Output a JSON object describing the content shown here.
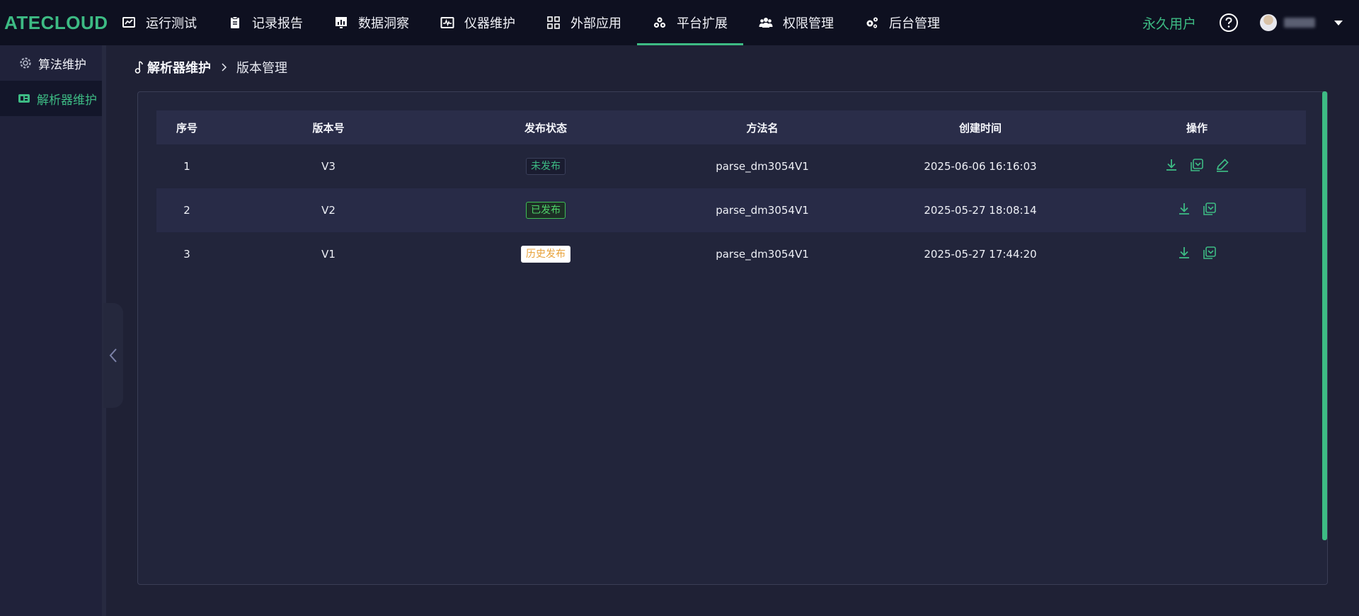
{
  "app": {
    "logo": "ATECLOUD"
  },
  "nav": {
    "items": [
      {
        "label": "运行测试",
        "icon": "chart-line-icon",
        "active": false
      },
      {
        "label": "记录报告",
        "icon": "clipboard-icon",
        "active": false
      },
      {
        "label": "数据洞察",
        "icon": "bar-chart-icon",
        "active": false
      },
      {
        "label": "仪器维护",
        "icon": "oscilloscope-icon",
        "active": false
      },
      {
        "label": "外部应用",
        "icon": "apps-grid-icon",
        "active": false
      },
      {
        "label": "平台扩展",
        "icon": "cubes-icon",
        "active": true
      },
      {
        "label": "权限管理",
        "icon": "users-icon",
        "active": false
      },
      {
        "label": "后台管理",
        "icon": "gears-icon",
        "active": false
      }
    ],
    "user_type": "永久用户"
  },
  "sidebar": {
    "items": [
      {
        "label": "算法维护",
        "icon": "gear-icon",
        "active": false
      },
      {
        "label": "解析器维护",
        "icon": "parser-icon",
        "active": true
      }
    ]
  },
  "breadcrumb": {
    "root": "解析器维护",
    "current": "版本管理"
  },
  "table": {
    "columns": [
      "序号",
      "版本号",
      "发布状态",
      "方法名",
      "创建时间",
      "操作"
    ],
    "rows": [
      {
        "index": "1",
        "version": "V3",
        "status": "未发布",
        "method": "parse_dm3054V1",
        "created": "2025-06-06 16:16:03"
      },
      {
        "index": "2",
        "version": "V2",
        "status": "已发布",
        "method": "parse_dm3054V1",
        "created": "2025-05-27 18:08:14"
      },
      {
        "index": "3",
        "version": "V1",
        "status": "历史发布",
        "method": "parse_dm3054V1",
        "created": "2025-05-27 17:44:20"
      }
    ]
  },
  "colors": {
    "accent": "#3dbb84",
    "topbar": "#0e1020",
    "background": "#1f2135"
  }
}
